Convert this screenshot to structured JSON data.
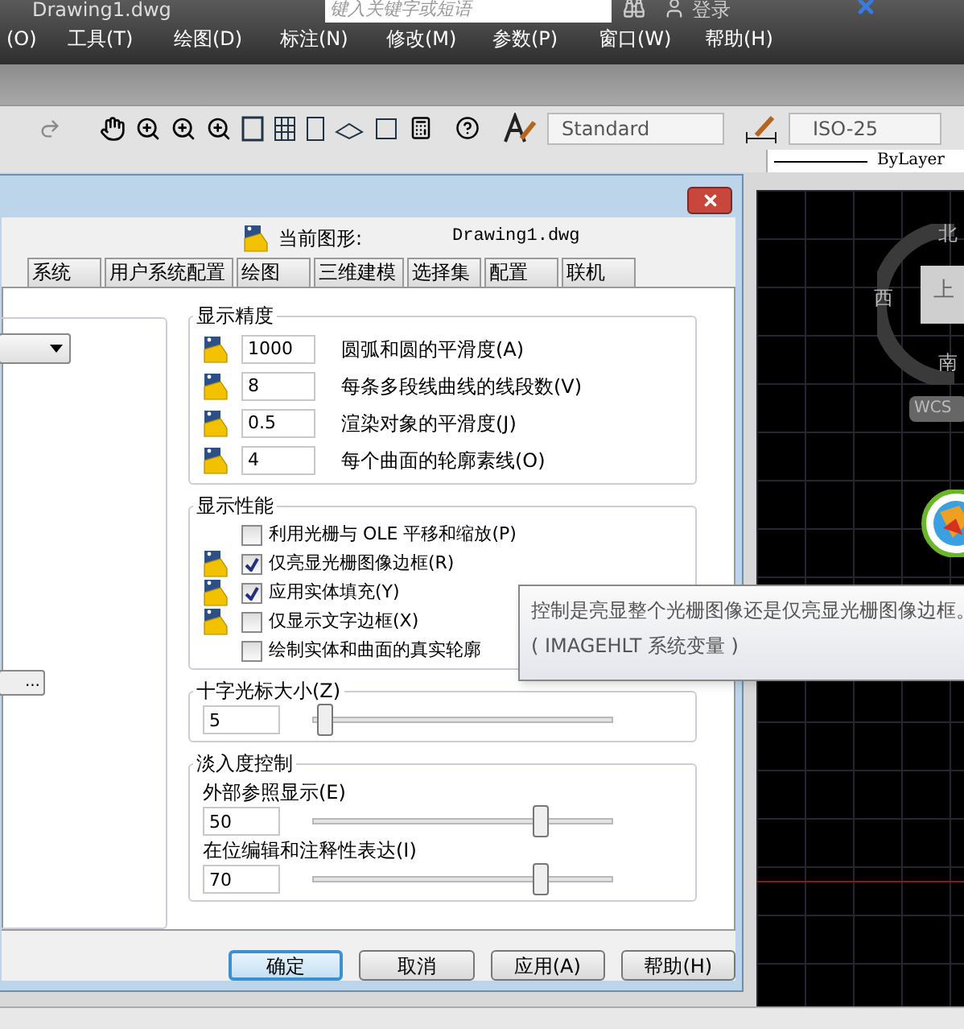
{
  "app": {
    "title": "Drawing1.dwg",
    "search": {
      "placeholder": "键入关键字或短语"
    },
    "user": "登录"
  },
  "menu": [
    "(O)",
    "工具(T)",
    "绘图(D)",
    "标注(N)",
    "修改(M)",
    "参数(P)",
    "窗口(W)",
    "帮助(H)"
  ],
  "toolbar": {
    "text_style": "Standard",
    "dim_style": "ISO-25",
    "linetype": "ByLayer"
  },
  "dialog": {
    "current_drawing_label": "当前图形:",
    "current_drawing": "Drawing1.dwg",
    "tabs": [
      {
        "label": "系统",
        "selected": false
      },
      {
        "label": "用户系统配置",
        "selected": false
      },
      {
        "label": "绘图",
        "selected": false
      },
      {
        "label": "三维建模",
        "selected": false
      },
      {
        "label": "选择集",
        "selected": false
      },
      {
        "label": "配置",
        "selected": false
      },
      {
        "label": "联机",
        "selected": false
      }
    ],
    "left_button": "...",
    "display_resolution": {
      "title": "显示精度",
      "rows": [
        {
          "value": "1000",
          "label": "圆弧和圆的平滑度(A)"
        },
        {
          "value": "8",
          "label": "每条多段线曲线的线段数(V)"
        },
        {
          "value": "0.5",
          "label": "渲染对象的平滑度(J)"
        },
        {
          "value": "4",
          "label": "每个曲面的轮廓素线(O)"
        }
      ]
    },
    "display_performance": {
      "title": "显示性能",
      "options": [
        {
          "label": "利用光栅与 OLE 平移和缩放(P)",
          "checked": false,
          "saved_in_drawing": false
        },
        {
          "label": "仅亮显光栅图像边框(R)",
          "checked": true,
          "saved_in_drawing": true
        },
        {
          "label": "应用实体填充(Y)",
          "checked": true,
          "saved_in_drawing": true
        },
        {
          "label": "仅显示文字边框(X)",
          "checked": false,
          "saved_in_drawing": true
        },
        {
          "label": "绘制实体和曲面的真实轮廓",
          "checked": false,
          "saved_in_drawing": false
        }
      ]
    },
    "crosshair": {
      "title": "十字光标大小(Z)",
      "value": "5",
      "level": 0.04
    },
    "fade": {
      "title": "淡入度控制",
      "rows": [
        {
          "label": "外部参照显示(E)",
          "value": "50",
          "level": 0.76
        },
        {
          "label": "在位编辑和注释性表达(I)",
          "value": "70",
          "level": 0.76
        }
      ]
    },
    "buttons": [
      {
        "label": "确定",
        "default": true
      },
      {
        "label": "取消",
        "default": false
      },
      {
        "label": "应用(A)",
        "default": false
      },
      {
        "label": "帮助(H)",
        "default": false
      }
    ]
  },
  "tooltip": {
    "lines": [
      "控制是亮显整个光栅图像还是仅亮显光栅图像边框。",
      "( IMAGEHLT 系统变量 )"
    ]
  },
  "viewcube": {
    "north": "北",
    "west": "西",
    "south": "南",
    "face": "上",
    "wcs": "WCS"
  }
}
